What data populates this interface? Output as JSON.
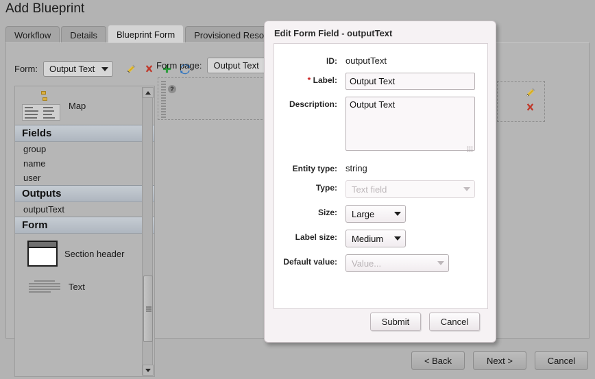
{
  "page": {
    "title": "Add Blueprint"
  },
  "tabs": [
    {
      "label": "Workflow",
      "active": false
    },
    {
      "label": "Details",
      "active": false
    },
    {
      "label": "Blueprint Form",
      "active": true
    },
    {
      "label": "Provisioned Resource",
      "active": false
    }
  ],
  "toolbar": {
    "form_label": "Form:",
    "form_value": "Output Text",
    "icons": [
      {
        "name": "edit-pencil-icon",
        "title": "Edit"
      },
      {
        "name": "delete-x-icon",
        "title": "Delete"
      },
      {
        "name": "add-plus-icon",
        "title": "Add"
      },
      {
        "name": "refresh-icon",
        "title": "Refresh"
      }
    ]
  },
  "palette": {
    "map_item": {
      "label": "Map"
    },
    "sections": [
      {
        "header": "Fields",
        "entries": [
          "group",
          "name",
          "user"
        ]
      },
      {
        "header": "Outputs",
        "entries": [
          "outputText"
        ]
      },
      {
        "header": "Form",
        "widgets": [
          {
            "label": "Section header",
            "icon": "section-header-thumb"
          },
          {
            "label": "Text",
            "icon": "text-thumb"
          }
        ]
      }
    ]
  },
  "canvas": {
    "form_page_label": "Form page:",
    "form_page_value": "Output Text",
    "help_glyph": "?"
  },
  "dialog": {
    "title_prefix": "Edit Form Field - ",
    "title_field": "outputText",
    "fields": {
      "id": {
        "label": "ID:",
        "value": "outputText"
      },
      "label": {
        "label": "Label:",
        "required": true,
        "required_mark": "*",
        "value": "Output Text"
      },
      "description": {
        "label": "Description:",
        "value": "Output Text"
      },
      "entity_type": {
        "label": "Entity type:",
        "value": "string"
      },
      "type": {
        "label": "Type:",
        "value": "Text field",
        "disabled": true
      },
      "size": {
        "label": "Size:",
        "value": "Large"
      },
      "label_size": {
        "label": "Label size:",
        "value": "Medium"
      },
      "default_value": {
        "label": "Default value:",
        "placeholder": "Value...",
        "value": ""
      }
    },
    "buttons": {
      "submit": "Submit",
      "cancel": "Cancel"
    }
  },
  "wizard": {
    "back": "< Back",
    "next": "Next >",
    "cancel": "Cancel"
  },
  "colors": {
    "chrome_bg": "#b3b3b3",
    "tab_active": "#d4d4d4",
    "dialog_bg": "#f6f2f4",
    "section_header": "#bcc3cb",
    "required_red": "#cc2222",
    "delete_red": "#c0392b",
    "add_green": "#2e9e3e",
    "refresh_blue": "#2f74c0"
  }
}
